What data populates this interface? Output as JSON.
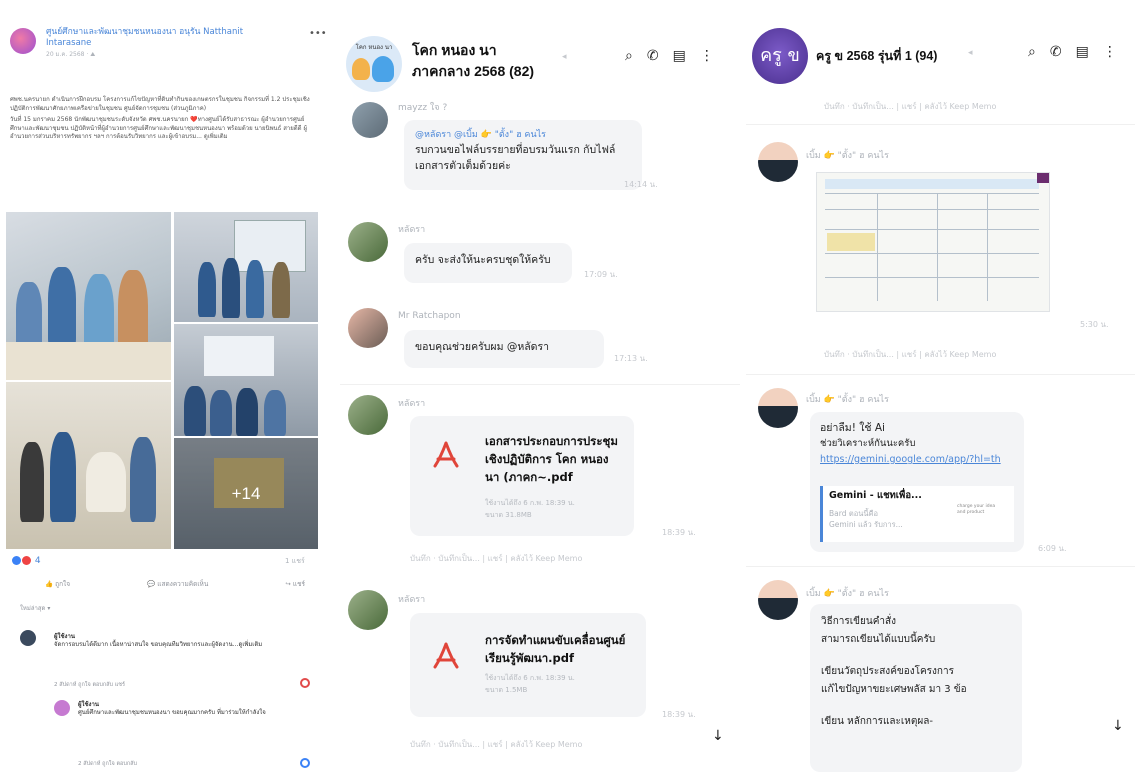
{
  "facebook_post": {
    "page_name": "ศูนย์ศึกษาและพัฒนาชุมชนหนองนา อนุรัน Natthanit Intarasane",
    "time": "20 ม.ค. 2568 · ⛰",
    "body_paragraph_1": "ศพช.นครนายก ดำเนินการฝึกอบรม โครงการแก้ไขปัญหาที่ดินทำกินของเกษตรกรในชุมชน กิจกรรมที่ 1.2 ประชุมเชิงปฏิบัติการพัฒนาศักยภาพเครือข่ายในชุมชน ศูนย์จัดการชุมชน (ส่วนภูมิภาค)",
    "body_paragraph_2": "วันที่ 15 มกราคม 2568 นักพัฒนาชุมชนระดับจังหวัด ศพช.นครนายก ❤️ทางศูนย์ได้รับสาธารณะ ผู้อำนวยการศูนย์ศึกษาและพัฒนาชุมชน ปฏิบัติหน้าที่ผู้อำนวยการศูนย์ศึกษาและพัฒนาชุมชนหนองนา พร้อมด้วย นายนิพนธ์ สายดีดี ผู้อำนวยการส่วนบริหารทรัพยากร ฯลฯ การต้อนรับวิทยากร และผู้เข้าอบรม... ดูเพิ่มเติม",
    "more_photos": "+14",
    "reaction_count": "4",
    "share_count": "1 แชร์",
    "actions": [
      "ถูกใจ",
      "แสดงความคิดเห็น",
      "แชร์"
    ],
    "sort_label": "ใหม่ล่าสุด ▾",
    "comments": [
      {
        "author": "ผู้ใช้งาน",
        "text": "จัดการอบรมได้ดีมาก เนื้อหาน่าสนใจ ขอบคุณทีมวิทยากรและผู้จัดงาน...ดูเพิ่มเติม",
        "meta": "2 สัปดาห์ ถูกใจ ตอบกลับ แชร์"
      },
      {
        "author": "ผู้ใช้งาน",
        "text": "ศูนย์ศึกษาและพัฒนาชุมชนหนองนา ขอบคุณมากครับ ที่มาร่วมให้กำลังใจ",
        "meta": "2 สัปดาห์ ถูกใจ ตอบกลับ"
      }
    ]
  },
  "chat1": {
    "title_line1": "โคก หนอง นา",
    "title_line2": "ภาคกลาง 2568 (82)",
    "avatar_caption": "โคก หนอง นา",
    "messages": [
      {
        "sender": "mayzz ใจ ?",
        "mention": "@หลัดรา @เบิ้ม 👉 \"ตั้ง\" ฮ คนไร",
        "text": "รบกวนขอไฟล์บรรยายที่อบรมวันแรก กับไฟล์เอกสารตัวเต็มด้วยค่ะ",
        "time": "14:14 น."
      },
      {
        "sender": "หลัดรา",
        "text": "ครับ จะส่งให้นะครบชุดให้ครับ",
        "time": "17:09 น."
      },
      {
        "sender": "Mr Ratchapon",
        "text": "ขอบคุณช่วยครับผม @หลัดรา",
        "time": "17:13 น."
      }
    ],
    "files": [
      {
        "sender": "หลัดรา",
        "name": "เอกสารประกอบการประชุมเชิงปฏิบัติการ โคก หนอง นา (ภาคก~.pdf",
        "meta1": "ใช้งานได้ถึง 6 ก.พ. 18:39 น.",
        "meta2": "ขนาด 31.8MB",
        "time": "18:39 น."
      },
      {
        "sender": "หลัดรา",
        "name": "การจัดทำแผนขับเคลื่อนศูนย์เรียนรู้พัฒนา.pdf",
        "meta1": "ใช้งานได้ถึง 6 ก.พ. 18:39 น.",
        "meta2": "ขนาด 1.5MB",
        "time": "18:39 น."
      }
    ],
    "save_note": "บันทึก · บันทึกเป็น... | แชร์ | คลังไว้ Keep Memo"
  },
  "chat2": {
    "title": "ครู ข 2568 รุ่นที่ 1 (94)",
    "avatar_caption": "ครู ข",
    "save_note": "บันทึก · บันทึกเป็น... | แชร์ | คลังไว้ Keep Memo",
    "messages": [
      {
        "sender": "เบิ้ม 👉 \"ตั้ง\" ฮ คนไร",
        "type": "image",
        "time": "5:30 น."
      },
      {
        "sender": "เบิ้ม 👉 \"ตั้ง\" ฮ คนไร",
        "line1": "อย่าลืม! ใช้ Ai",
        "line2": "ช่วยวิเคราะห์กันนะครับ",
        "link": "https://gemini.google.com/app/?hl=th",
        "preview_title": "Gemini - แชทเพื่อ...",
        "preview_sub1": "Bard ตอนนี้คือ",
        "preview_sub2": "Gemini แล้ว รับการ...",
        "preview_side": "charge your idea and product",
        "time": "6:09 น."
      },
      {
        "sender": "เบิ้ม 👉 \"ตั้ง\" ฮ คนไร",
        "line1": "วิธีการเขียนคำสั่ง",
        "line2": "สามารถเขียนได้แบบนี้ครับ",
        "line3": "เขียนวัตถุประสงค์ของโครงการ",
        "line4": "แก้ไขปัญหาขยะเศษพลัส มา 3 ข้อ",
        "line5": "เขียน หลักการและเหตุผล-"
      }
    ]
  }
}
